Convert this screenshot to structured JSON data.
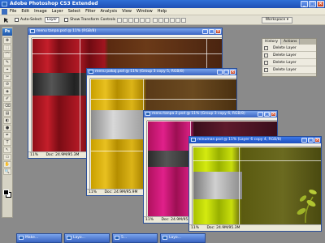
{
  "app": {
    "title": "Adobe Photoshop CS3 Extended"
  },
  "window_controls": {
    "minimize": "_",
    "maximize": "□",
    "close": "×"
  },
  "menu": [
    "File",
    "Edit",
    "Image",
    "Layer",
    "Select",
    "Filter",
    "Analysis",
    "View",
    "Window",
    "Help"
  ],
  "options_bar": {
    "auto_select_label": "Auto-Select:",
    "auto_select_value": "Layer",
    "transform_label": "Show Transform Controls",
    "workspace_label": "Workspace ▾"
  },
  "toolbox": {
    "logo": "Ps",
    "tools": [
      "✥",
      "⬚",
      "⌒",
      "✎",
      "⌖",
      "✂",
      "⊘",
      "◈",
      "✐",
      "⌫",
      "▤",
      "◐",
      "●",
      "✒",
      "T",
      "↖",
      "▭",
      "✋",
      "🔍"
    ]
  },
  "layers_panel": {
    "tabs": [
      "History",
      "Actions"
    ],
    "rows": [
      "Delete Layer",
      "Delete Layer",
      "Delete Layer",
      "Delete Layer"
    ]
  },
  "documents": [
    {
      "title": "menu tanpa.psd @ 11% (RGB/8)",
      "zoom": "11%",
      "status": "Doc: 24.9M/95.3M"
    },
    {
      "title": "menu pakaj.psd @ 11% (Group 3 copy 5, RGB/8)",
      "zoom": "11%",
      "status": "Doc: 24.9M/95.9M"
    },
    {
      "title": "menu tanpa 2.psd @ 11% (Group 3 copy 6, RGB/8)",
      "zoom": "11%",
      "status": "Doc: 24.9M/95.9M"
    },
    {
      "title": "minuman.psd @ 11% (Layer 6 copy 4, RGB/8)",
      "zoom": "11%",
      "status": "Doc: 24.9M/95.3M"
    }
  ],
  "taskbar": [
    "Make...",
    "Layo...",
    "5...",
    "Layo..."
  ]
}
